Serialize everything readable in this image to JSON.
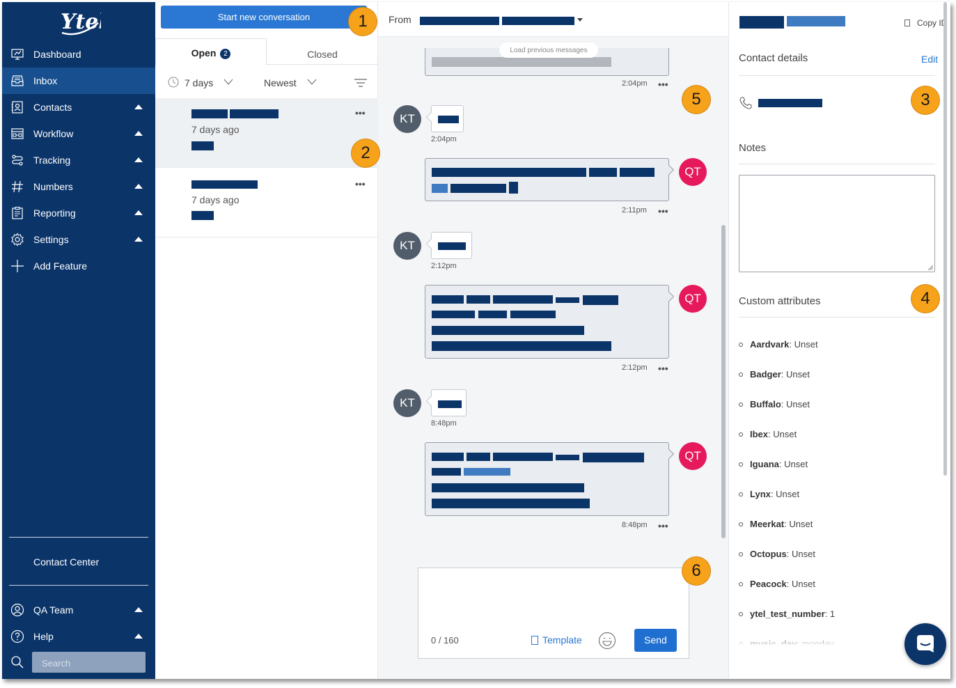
{
  "sidebar": {
    "logo_text": "Ytel",
    "items": [
      {
        "label": "Dashboard",
        "icon": "dashboard-icon",
        "active": false,
        "expandable": false
      },
      {
        "label": "Inbox",
        "icon": "inbox-icon",
        "active": true,
        "expandable": false
      },
      {
        "label": "Contacts",
        "icon": "contacts-icon",
        "active": false,
        "expandable": true
      },
      {
        "label": "Workflow",
        "icon": "workflow-icon",
        "active": false,
        "expandable": true
      },
      {
        "label": "Tracking",
        "icon": "tracking-icon",
        "active": false,
        "expandable": true
      },
      {
        "label": "Numbers",
        "icon": "hash-icon",
        "active": false,
        "expandable": true
      },
      {
        "label": "Reporting",
        "icon": "reporting-icon",
        "active": false,
        "expandable": true
      },
      {
        "label": "Settings",
        "icon": "gear-icon",
        "active": false,
        "expandable": true
      },
      {
        "label": "Add Feature",
        "icon": "plus-icon",
        "active": false,
        "expandable": false
      }
    ],
    "contact_center": "Contact Center",
    "team": "QA Team",
    "help": "Help",
    "search_placeholder": "Search"
  },
  "conversations": {
    "new_button": "Start new conversation",
    "tabs": {
      "open": "Open",
      "open_count": "2",
      "closed": "Closed"
    },
    "filters": {
      "range": "7 days",
      "sort": "Newest"
    },
    "items": [
      {
        "time": "7 days ago",
        "selected": true
      },
      {
        "time": "7 days ago",
        "selected": false
      }
    ]
  },
  "chat": {
    "from_label": "From",
    "load_previous": "Load previous messages",
    "messages": [
      {
        "direction": "out",
        "initials": "QT",
        "time": "2:04pm",
        "partial": true
      },
      {
        "direction": "in",
        "initials": "KT",
        "time": "2:04pm"
      },
      {
        "direction": "out",
        "initials": "QT",
        "time": "2:11pm"
      },
      {
        "direction": "in",
        "initials": "KT",
        "time": "2:12pm"
      },
      {
        "direction": "out",
        "initials": "QT",
        "time": "2:12pm"
      },
      {
        "direction": "in",
        "initials": "KT",
        "time": "8:48pm"
      },
      {
        "direction": "out",
        "initials": "QT",
        "time": "8:48pm"
      }
    ],
    "composer": {
      "char_count": "0 / 160",
      "template_label": "Template",
      "send_label": "Send"
    }
  },
  "contact_panel": {
    "copy_id": "Copy ID",
    "contact_details": "Contact details",
    "edit": "Edit",
    "notes": "Notes",
    "custom_attributes": "Custom attributes",
    "attributes": [
      {
        "name": "Aardvark",
        "value": "Unset"
      },
      {
        "name": "Badger",
        "value": "Unset"
      },
      {
        "name": "Buffalo",
        "value": "Unset"
      },
      {
        "name": "Ibex",
        "value": "Unset"
      },
      {
        "name": "Iguana",
        "value": "Unset"
      },
      {
        "name": "Lynx",
        "value": "Unset"
      },
      {
        "name": "Meerkat",
        "value": "Unset"
      },
      {
        "name": "Octopus",
        "value": "Unset"
      },
      {
        "name": "Peacock",
        "value": "Unset"
      },
      {
        "name": "ytel_test_number",
        "value": "1"
      },
      {
        "name": "music_day",
        "value": "monday"
      }
    ]
  },
  "callouts": [
    "1",
    "2",
    "3",
    "4",
    "5",
    "6"
  ],
  "colors": {
    "sidebar_bg": "#0b3469",
    "sidebar_active": "#18508f",
    "primary_button": "#2a78d3",
    "callout": "#f7a21b",
    "avatar_kt": "#525d6b",
    "avatar_qt": "#e5195c",
    "redaction": "#0b3469"
  }
}
